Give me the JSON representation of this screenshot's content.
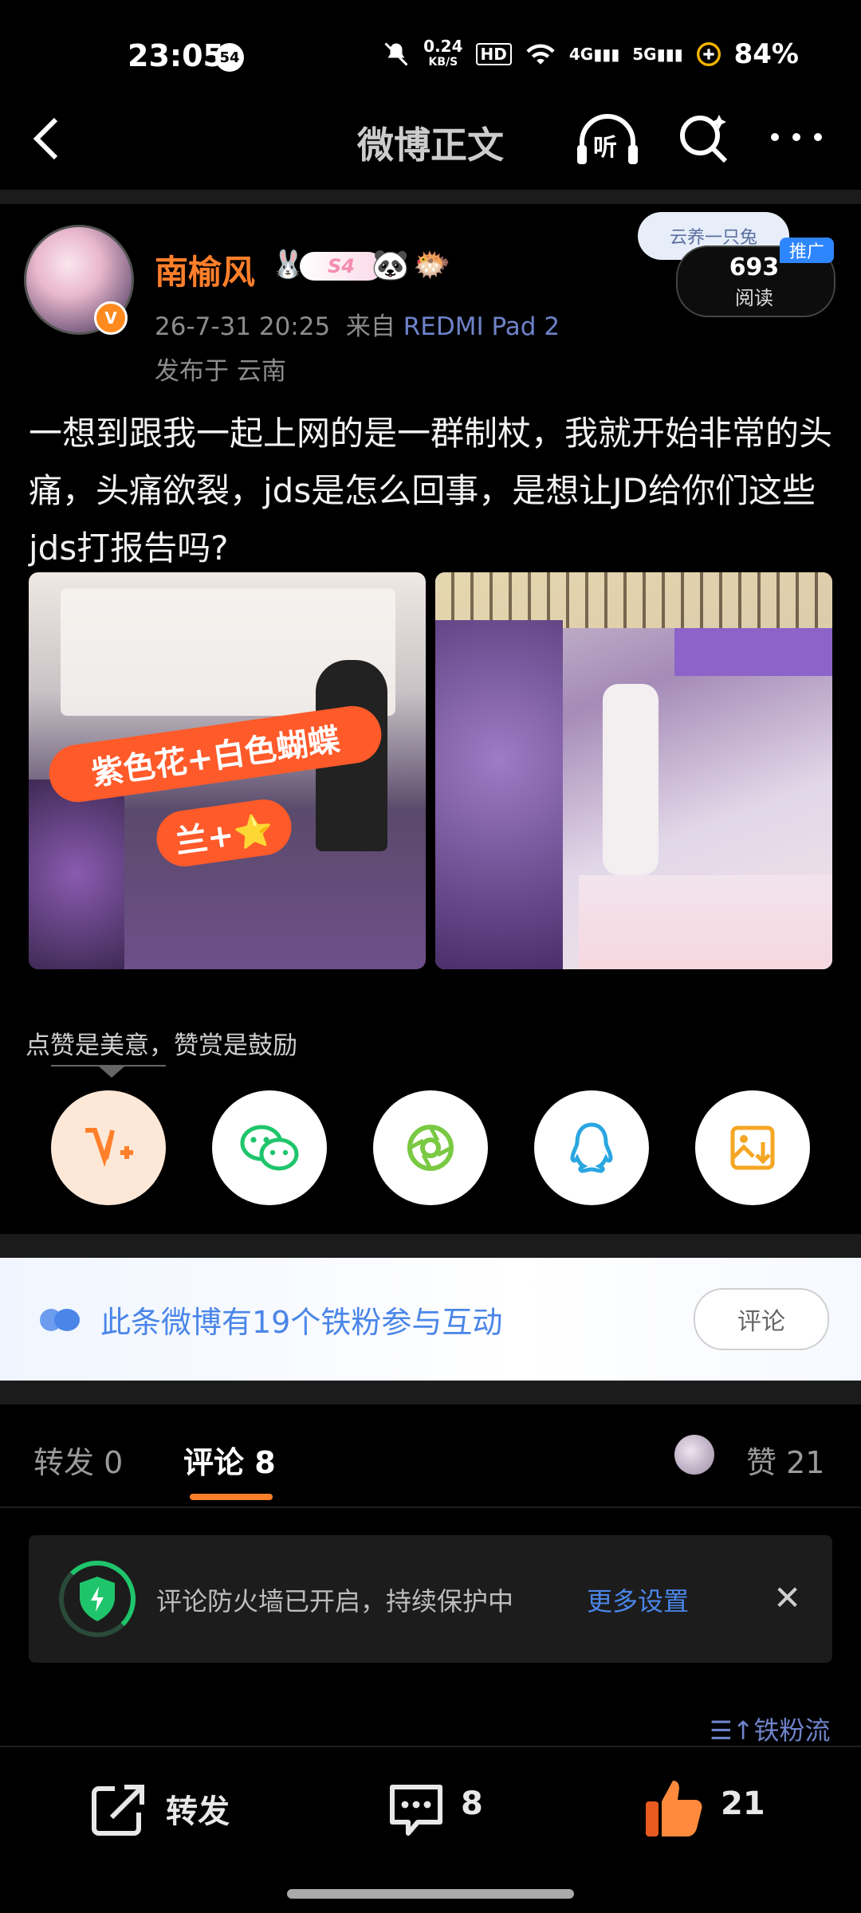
{
  "status_bar": {
    "time": "23:05",
    "notification_badge": "54",
    "network_speed_value": "0.24",
    "network_speed_unit": "KB/S",
    "battery": "84%",
    "network_4g": "4G",
    "network_5g": "5G",
    "hd_label": "HD"
  },
  "nav": {
    "title": "微博正文",
    "listen_label": "听"
  },
  "post": {
    "author": "南榆风",
    "level": "S4",
    "timestamp": "26-7-31 20:25",
    "source_prefix": "来自",
    "device": "REDMI Pad 2",
    "location": "发布于 云南",
    "promo_deco_text": "云养一只兔",
    "read_count": "693",
    "read_label": "阅读",
    "promo_tag": "推广",
    "text": "一想到跟我一起上网的是一群制杖，我就开始非常的头痛，头痛欲裂，jds是怎么回事，是想让JD给你们这些jds打报告吗?",
    "image1_overlay_line1": "紫色花+白色蝴蝶",
    "image1_overlay_line2": "兰+⭐"
  },
  "reward": {
    "hint": "点赞是美意，赞赏是鼓励"
  },
  "share_buttons": [
    {
      "name": "vplus",
      "icon": "vplus-icon"
    },
    {
      "name": "wechat",
      "icon": "wechat-icon"
    },
    {
      "name": "moments",
      "icon": "moments-icon"
    },
    {
      "name": "qq",
      "icon": "qq-icon"
    },
    {
      "name": "save-image",
      "icon": "save-image-icon"
    }
  ],
  "fans_banner": {
    "text": "此条微博有19个铁粉参与互动",
    "button": "评论"
  },
  "tabs": {
    "repost": "转发 0",
    "comment": "评论 8",
    "like": "赞 21"
  },
  "firewall": {
    "text": "评论防火墙已开启，持续保护中",
    "link": "更多设置"
  },
  "sort": {
    "label": "铁粉流"
  },
  "bottom_bar": {
    "repost": "转发",
    "comment_count": "8",
    "like_count": "21"
  },
  "colors": {
    "brand_orange": "#ff7f2a",
    "link_blue": "#4a86e8",
    "background": "#000000"
  }
}
